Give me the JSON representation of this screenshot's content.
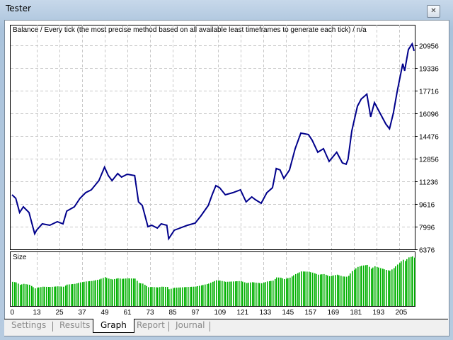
{
  "window": {
    "title": "Tester",
    "close_icon": "close-icon"
  },
  "tabs": [
    {
      "label": "Settings"
    },
    {
      "label": "Results"
    },
    {
      "label": "Graph",
      "active": true
    },
    {
      "label": "Report"
    },
    {
      "label": "Journal"
    }
  ],
  "chart_data": {
    "type": "line",
    "title": "Balance / Every tick (the most precise method based on all available least timeframes to generate each tick) / n/a",
    "ylabel": "",
    "xlabel": "",
    "ylim": [
      6376,
      22416
    ],
    "y_ticks": [
      20956,
      19336,
      17716,
      16096,
      14476,
      12856,
      11236,
      9616,
      7996,
      6376
    ],
    "x_ticks": [
      0,
      13,
      25,
      37,
      49,
      61,
      73,
      85,
      97,
      109,
      121,
      133,
      145,
      157,
      169,
      181,
      193,
      205
    ],
    "xlim": [
      0,
      214
    ],
    "grid": true,
    "line_color": "#00008b",
    "bar_color": "#00b000",
    "series": [
      {
        "name": "Balance",
        "points": [
          [
            0,
            10273
          ],
          [
            2,
            10021
          ],
          [
            4,
            9009
          ],
          [
            6,
            9413
          ],
          [
            9,
            9009
          ],
          [
            12,
            7490
          ],
          [
            13,
            7743
          ],
          [
            16,
            8198
          ],
          [
            20,
            8097
          ],
          [
            24,
            8350
          ],
          [
            27,
            8198
          ],
          [
            29,
            9109
          ],
          [
            33,
            9413
          ],
          [
            36,
            10021
          ],
          [
            39,
            10426
          ],
          [
            42,
            10628
          ],
          [
            46,
            11286
          ],
          [
            49,
            12248
          ],
          [
            51,
            11641
          ],
          [
            53,
            11286
          ],
          [
            56,
            11792
          ],
          [
            58,
            11539
          ],
          [
            61,
            11742
          ],
          [
            65,
            11641
          ],
          [
            67,
            9768
          ],
          [
            69,
            9515
          ],
          [
            72,
            7996
          ],
          [
            74,
            8097
          ],
          [
            77,
            7895
          ],
          [
            79,
            8198
          ],
          [
            82,
            8097
          ],
          [
            83,
            7135
          ],
          [
            86,
            7743
          ],
          [
            89,
            7895
          ],
          [
            93,
            8097
          ],
          [
            97,
            8249
          ],
          [
            100,
            8755
          ],
          [
            104,
            9515
          ],
          [
            106,
            10273
          ],
          [
            108,
            10932
          ],
          [
            110,
            10780
          ],
          [
            113,
            10273
          ],
          [
            117,
            10426
          ],
          [
            121,
            10628
          ],
          [
            124,
            9768
          ],
          [
            127,
            10120
          ],
          [
            129,
            9918
          ],
          [
            132,
            9666
          ],
          [
            135,
            10426
          ],
          [
            138,
            10780
          ],
          [
            140,
            12147
          ],
          [
            142,
            12046
          ],
          [
            144,
            11439
          ],
          [
            147,
            12046
          ],
          [
            150,
            13565
          ],
          [
            153,
            14678
          ],
          [
            157,
            14577
          ],
          [
            159,
            14172
          ],
          [
            162,
            13312
          ],
          [
            165,
            13565
          ],
          [
            168,
            12654
          ],
          [
            172,
            13312
          ],
          [
            175,
            12552
          ],
          [
            177,
            12451
          ],
          [
            178,
            12805
          ],
          [
            180,
            14830
          ],
          [
            183,
            16602
          ],
          [
            185,
            17109
          ],
          [
            188,
            17463
          ],
          [
            190,
            15843
          ],
          [
            192,
            16855
          ],
          [
            195,
            16096
          ],
          [
            198,
            15336
          ],
          [
            200,
            14982
          ],
          [
            202,
            16096
          ],
          [
            204,
            17615
          ],
          [
            207,
            19640
          ],
          [
            208,
            19133
          ],
          [
            210,
            20652
          ],
          [
            212,
            21057
          ],
          [
            213,
            20551
          ]
        ]
      }
    ],
    "sub_panel": {
      "label": "Size",
      "type": "bar"
    }
  }
}
